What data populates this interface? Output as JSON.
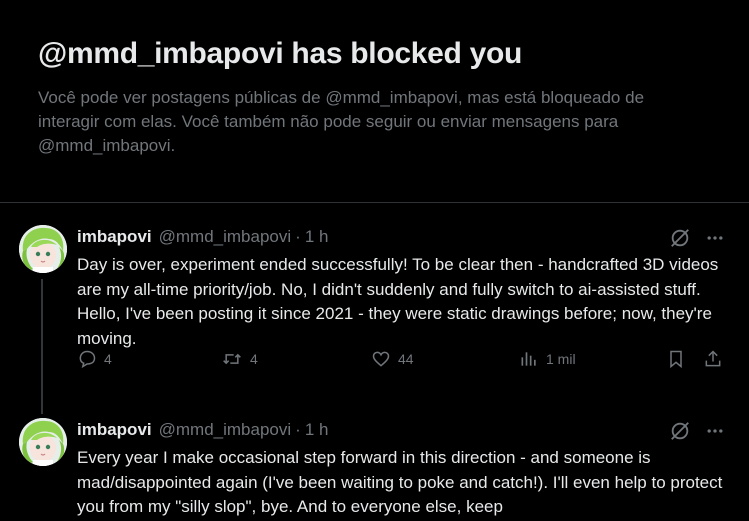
{
  "blocked": {
    "title": "@mmd_imbapovi has blocked you",
    "description": "Você pode ver postagens públicas de @mmd_imbapovi, mas está bloqueado de interagir com elas. Você também não pode seguir ou enviar mensagens para @mmd_imbapovi."
  },
  "tweets": [
    {
      "name": "imbapovi",
      "handle": "@mmd_imbapovi",
      "dot": "·",
      "time": "1 h",
      "text": "Day is over, experiment ended successfully! To be clear then - handcrafted 3D videos are my all-time priority/job. No, I didn't suddenly and fully switch to ai-assisted stuff. Hello, I've been posting it since 2021 - they were static drawings before; now, they're moving.",
      "replies": "4",
      "retweets": "4",
      "likes": "44",
      "views": "1 mil"
    },
    {
      "name": "imbapovi",
      "handle": "@mmd_imbapovi",
      "dot": "·",
      "time": "1 h",
      "text": "Every year I make occasional step forward in this direction - and someone is mad/disappointed again (I've been waiting to poke and catch!). I'll even help to protect you from my \"silly slop\", bye. And to everyone else, keep"
    }
  ],
  "icons": {
    "grok": "grok-icon",
    "more": "more-icon",
    "reply": "reply-icon",
    "retweet": "retweet-icon",
    "like": "heart-icon",
    "views": "views-icon",
    "bookmark": "bookmark-icon",
    "share": "share-icon"
  },
  "colors": {
    "background": "#000000",
    "text": "#e7e9ea",
    "secondary": "#71767b",
    "border": "#2f3336"
  }
}
